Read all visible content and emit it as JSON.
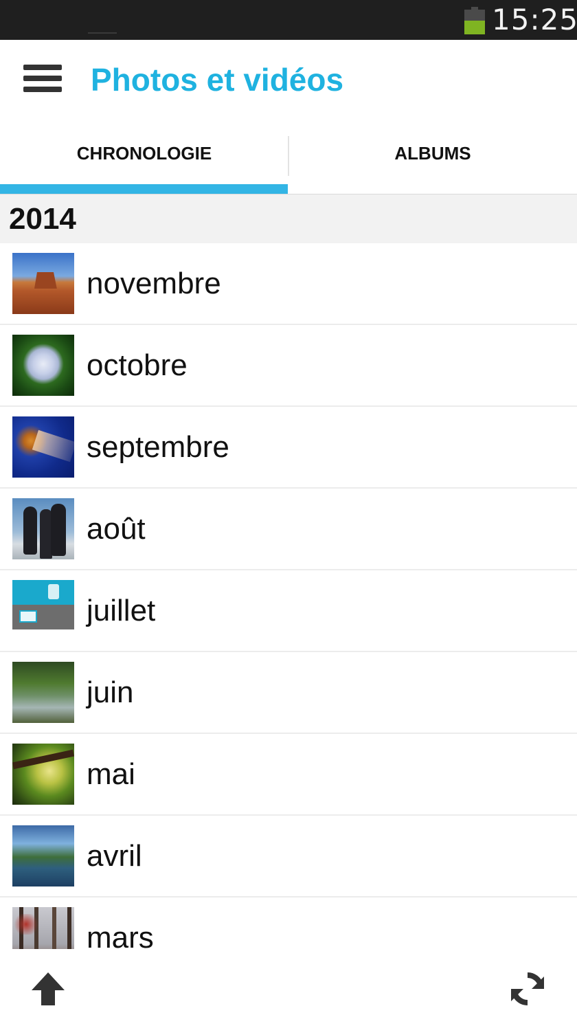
{
  "status_bar": {
    "time": "15:25",
    "battery_icon": "battery-icon",
    "battery_color": "#7fb422"
  },
  "app_bar": {
    "menu_icon": "hamburger-menu-icon",
    "title": "Photos et vidéos",
    "title_color": "#1fb2e0"
  },
  "tabs": {
    "items": [
      {
        "label": "CHRONOLOGIE",
        "selected": true
      },
      {
        "label": "ALBUMS",
        "selected": false
      }
    ],
    "indicator_color": "#33b5e5"
  },
  "timeline": {
    "year": "2014",
    "months": [
      {
        "label": "novembre",
        "thumbnail": "desert-buttes-thumbnail"
      },
      {
        "label": "octobre",
        "thumbnail": "hydrangea-thumbnail"
      },
      {
        "label": "septembre",
        "thumbnail": "jellyfish-thumbnail"
      },
      {
        "label": "août",
        "thumbnail": "penguins-thumbnail"
      },
      {
        "label": "juillet",
        "thumbnail": "screenshot-thumbnail"
      },
      {
        "label": "juin",
        "thumbnail": "forest-stream-thumbnail"
      },
      {
        "label": "mai",
        "thumbnail": "green-forest-thumbnail"
      },
      {
        "label": "avril",
        "thumbnail": "lake-thumbnail"
      },
      {
        "label": "mars",
        "thumbnail": "misty-trees-thumbnail"
      }
    ]
  },
  "bottom_bar": {
    "upload_icon": "upload-arrow-icon",
    "sync_icon": "sync-icon"
  }
}
